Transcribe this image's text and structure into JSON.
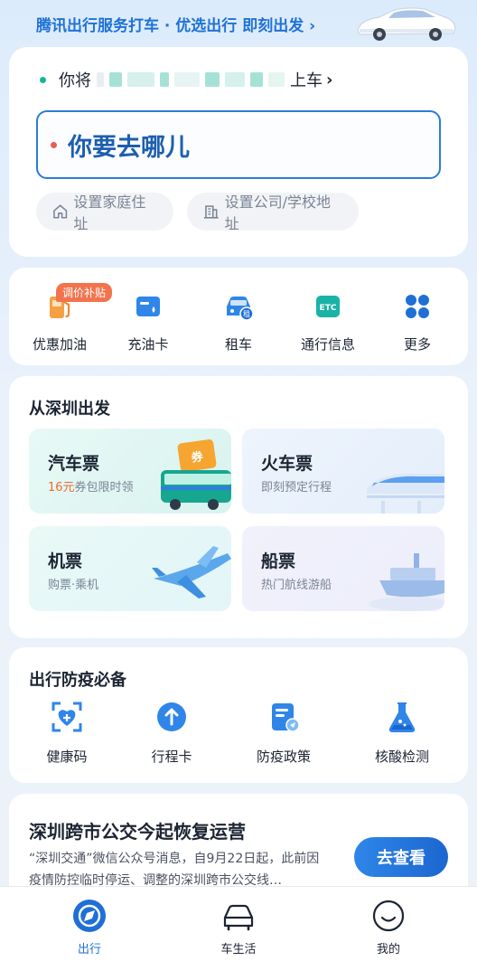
{
  "banner": {
    "text": "腾讯出行服务打车 · 优选出行 即刻出发 ›"
  },
  "pickup": {
    "prefix": "你将",
    "suffix": "上车",
    "chevron": "›"
  },
  "destination": {
    "placeholder": "你要去哪儿"
  },
  "shortcuts": {
    "home": "设置家庭住址",
    "work": "设置公司/学校地址"
  },
  "services": {
    "badge": "调价补贴",
    "items": [
      {
        "label": "优惠加油",
        "icon": "fuel-pump-icon"
      },
      {
        "label": "充油卡",
        "icon": "fuel-card-icon"
      },
      {
        "label": "租车",
        "icon": "car-rental-icon"
      },
      {
        "label": "通行信息",
        "icon": "etc-icon"
      },
      {
        "label": "更多",
        "icon": "more-grid-icon"
      }
    ]
  },
  "departure": {
    "title": "从深圳出发",
    "tickets": [
      {
        "title": "汽车票",
        "sub_highlight": "16元",
        "sub": "券包限时领"
      },
      {
        "title": "火车票",
        "sub": "即刻预定行程"
      },
      {
        "title": "机票",
        "sub": "购票·乘机"
      },
      {
        "title": "船票",
        "sub": "热门航线游船"
      }
    ],
    "coupon_text": "券"
  },
  "epidemic": {
    "title": "出行防疫必备",
    "items": [
      {
        "label": "健康码",
        "icon": "health-code-icon"
      },
      {
        "label": "行程卡",
        "icon": "itinerary-card-icon"
      },
      {
        "label": "防疫政策",
        "icon": "policy-icon"
      },
      {
        "label": "核酸检测",
        "icon": "flask-icon"
      }
    ]
  },
  "news": {
    "title": "深圳跨市公交今起恢复运营",
    "body": "“深圳交通”微信公众号消息，自9月22日起，此前因疫情防控临时停运、调整的深圳跨市公交线…",
    "button": "去查看"
  },
  "tabbar": {
    "items": [
      {
        "label": "出行",
        "active": true
      },
      {
        "label": "车生活",
        "active": false
      },
      {
        "label": "我的",
        "active": false
      }
    ]
  },
  "colors": {
    "accent": "#1f6fd6",
    "highlight": "#f06a2b",
    "badge": "#f2744e"
  }
}
